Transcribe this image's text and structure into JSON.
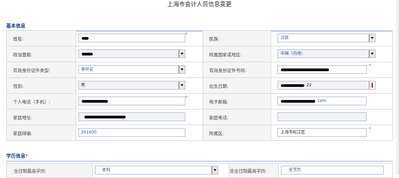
{
  "page": {
    "title": "上海市会计人员信息变更"
  },
  "basic": {
    "heading": "基本信息",
    "fields": {
      "name": {
        "label": "姓名:"
      },
      "ethnicity": {
        "label": "民族:",
        "value": "汉族"
      },
      "political": {
        "label": "政治面貌:"
      },
      "region": {
        "label": "所属国家或地区:",
        "value": "中国（内地）"
      },
      "id_type": {
        "label": "有效身份证件类型:",
        "value": "身份证"
      },
      "id_number": {
        "label": "有效身份证件号码:"
      },
      "gender": {
        "label": "性别:",
        "value": "男"
      },
      "birthdate": {
        "label": "出生日期:",
        "value_suffix": "22"
      },
      "mobile": {
        "label": "个人电话（手机）:"
      },
      "email": {
        "label": "电子邮箱:",
        "value_suffix": "com"
      },
      "home_address": {
        "label": "家庭地址:"
      },
      "home_phone": {
        "label": "家庭电话:"
      },
      "postcode": {
        "label": "家庭邮编:",
        "value": "201600"
      },
      "district": {
        "label": "所属区:",
        "value": "上海市松江区"
      }
    }
  },
  "education": {
    "heading": "学历信息",
    "required_mark": "*",
    "fields": {
      "fulltime_edu": {
        "label": "全日制最高学历:",
        "value": "本科"
      },
      "parttime_edu": {
        "label": "非全日制最高学历:",
        "value": "无学历"
      }
    }
  },
  "required_mark": "*"
}
